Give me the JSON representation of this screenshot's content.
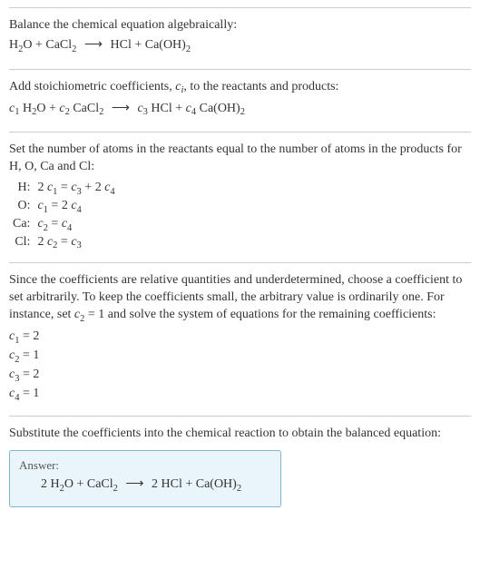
{
  "section1": {
    "intro": "Balance the chemical equation algebraically:",
    "eq_lhs1": "H",
    "eq_lhs1_sub": "2",
    "eq_lhs2": "O + CaCl",
    "eq_lhs2_sub": "2",
    "arrow": "⟶",
    "eq_rhs1": "HCl + Ca(OH)",
    "eq_rhs1_sub": "2"
  },
  "section2": {
    "intro1": "Add stoichiometric coefficients, ",
    "ci": "c",
    "ci_sub": "i",
    "intro2": ", to the reactants and products:",
    "c1": "c",
    "c1s": "1",
    "sp1": " H",
    "sp1s": "2",
    "sp1b": "O + ",
    "c2": "c",
    "c2s": "2",
    "sp2": " CaCl",
    "sp2s": "2",
    "arrow": "⟶",
    "c3": "c",
    "c3s": "3",
    "sp3": " HCl + ",
    "c4": "c",
    "c4s": "4",
    "sp4": " Ca(OH)",
    "sp4s": "2"
  },
  "section3": {
    "intro": "Set the number of atoms in the reactants equal to the number of atoms in the products for H, O, Ca and Cl:",
    "rows": [
      {
        "label": "H:",
        "lhs_a": "2 ",
        "lhs_c": "c",
        "lhs_s": "1",
        "mid": " = ",
        "r1c": "c",
        "r1s": "3",
        "plus": " + 2 ",
        "r2c": "c",
        "r2s": "4"
      },
      {
        "label": "O:",
        "lhs_a": "",
        "lhs_c": "c",
        "lhs_s": "1",
        "mid": " = 2 ",
        "r1c": "c",
        "r1s": "4",
        "plus": "",
        "r2c": "",
        "r2s": ""
      },
      {
        "label": "Ca:",
        "lhs_a": "",
        "lhs_c": "c",
        "lhs_s": "2",
        "mid": " = ",
        "r1c": "c",
        "r1s": "4",
        "plus": "",
        "r2c": "",
        "r2s": ""
      },
      {
        "label": "Cl:",
        "lhs_a": "2 ",
        "lhs_c": "c",
        "lhs_s": "2",
        "mid": " = ",
        "r1c": "c",
        "r1s": "3",
        "plus": "",
        "r2c": "",
        "r2s": ""
      }
    ]
  },
  "section4": {
    "para1": "Since the coefficients are relative quantities and underdetermined, choose a coefficient to set arbitrarily. To keep the coefficients small, the arbitrary value is ordinarily one. For instance, set ",
    "setc": "c",
    "setcs": "2",
    "para2": " = 1 and solve the system of equations for the remaining coefficients:",
    "coefs": [
      {
        "c": "c",
        "s": "1",
        "eq": " = 2"
      },
      {
        "c": "c",
        "s": "2",
        "eq": " = 1"
      },
      {
        "c": "c",
        "s": "3",
        "eq": " = 2"
      },
      {
        "c": "c",
        "s": "4",
        "eq": " = 1"
      }
    ]
  },
  "section5": {
    "intro": "Substitute the coefficients into the chemical reaction to obtain the balanced equation:",
    "answer_label": "Answer:",
    "eq_a": "2 H",
    "eq_as": "2",
    "eq_b": "O + CaCl",
    "eq_bs": "2",
    "arrow": "⟶",
    "eq_c": "2 HCl + Ca(OH)",
    "eq_cs": "2"
  }
}
